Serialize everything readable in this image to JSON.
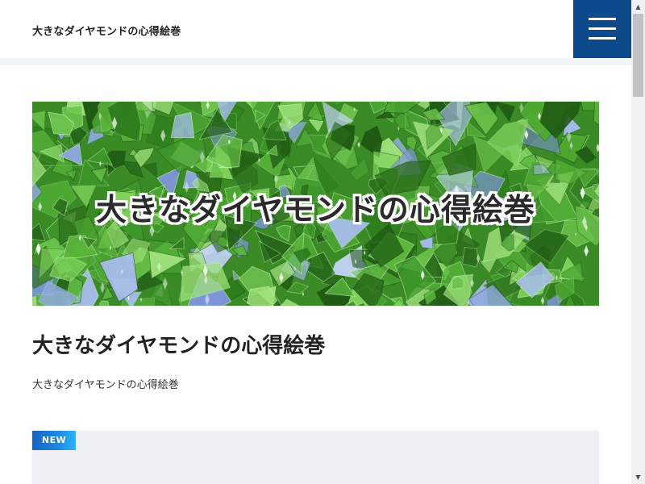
{
  "header": {
    "site_title": "大きなダイヤモンドの心得絵巻",
    "menu_icon": "hamburger-menu-icon",
    "accent_color": "#0d4a8c"
  },
  "hero": {
    "banner_text": "大きなダイヤモンドの心得絵巻",
    "image_subject": "green-crystals"
  },
  "main": {
    "heading": "大きなダイヤモンドの心得絵巻",
    "description": "大きなダイヤモンドの心得絵巻"
  },
  "card": {
    "badge": "NEW",
    "badge_color": "#1e88e5"
  },
  "scrollbar": {
    "up_icon": "scroll-up-arrow-icon",
    "down_icon": "scroll-down-arrow-icon"
  }
}
